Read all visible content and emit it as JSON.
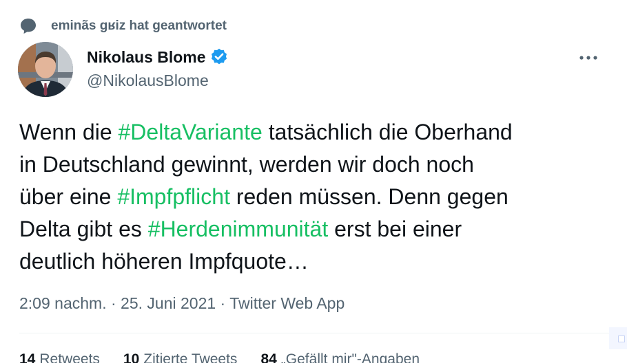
{
  "reply_context": {
    "icon": "speech-bubble-icon",
    "text": "eminãs gʁiz hat geantwortet"
  },
  "author": {
    "name": "Nikolaus Blome",
    "handle": "@NikolausBlome",
    "verified": true,
    "verified_icon": "verified-badge-icon"
  },
  "more_icon": "more-horizontal-icon",
  "tweet": {
    "lines": [
      [
        {
          "text": "Wenn die ",
          "hashtag": false
        },
        {
          "text": "#DeltaVariante",
          "hashtag": true
        },
        {
          "text": " tatsächlich die Oberhand",
          "hashtag": false
        }
      ],
      [
        {
          "text": "in Deutschland gewinnt, werden wir doch noch",
          "hashtag": false
        }
      ],
      [
        {
          "text": "über eine ",
          "hashtag": false
        },
        {
          "text": "#Impfpflicht",
          "hashtag": true
        },
        {
          "text": " reden müssen. Denn gegen",
          "hashtag": false
        }
      ],
      [
        {
          "text": "Delta gibt es ",
          "hashtag": false
        },
        {
          "text": "#Herdenimmunität",
          "hashtag": true
        },
        {
          "text": " erst bei einer",
          "hashtag": false
        }
      ],
      [
        {
          "text": "deutlich höheren Impfquote…",
          "hashtag": false
        }
      ]
    ]
  },
  "meta": {
    "time": "2:09 nachm.",
    "separator": " · ",
    "date": "25. Juni 2021",
    "app": "Twitter Web App"
  },
  "stats": [
    {
      "count": "14",
      "label": "Retweets"
    },
    {
      "count": "10",
      "label": "Zitierte Tweets"
    },
    {
      "count": "84",
      "label": "„Gefällt mir\"-Angaben"
    }
  ],
  "colors": {
    "hashtag": "#17bf63",
    "secondary_text": "#536471",
    "primary_text": "#0f1419",
    "verified": "#1d9bf0"
  }
}
